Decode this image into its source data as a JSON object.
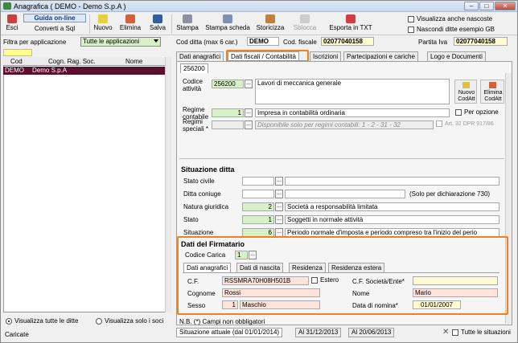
{
  "window": {
    "title": "Anagrafica ( DEMO - Demo S.p.A )",
    "min": "–",
    "max": "□",
    "close": "✕"
  },
  "toolbar": {
    "esci": "Esci",
    "guida": "Guida on-line",
    "converti": "Converti a Sql",
    "nuovo": "Nuovo",
    "elimina": "Elimina",
    "salva": "Salva",
    "stampa": "Stampa",
    "stampa_scheda": "Stampa scheda",
    "storicizza": "Storicizza",
    "sblocca": "Sblocca",
    "esporta": "Esporta in TXT",
    "opt1": "Visualizza anche nascoste",
    "opt2": "Nascondi ditte esempio GB"
  },
  "filter": {
    "label": "Filtra per applicazione",
    "value": "Tutte le applicazioni"
  },
  "list": {
    "headers": [
      "Cod",
      "Cogn. Rag. Soc.",
      "Nome"
    ],
    "rows": [
      {
        "cod": "DEMO",
        "name": "Demo S.p.A",
        "nome": ""
      }
    ]
  },
  "left_bottom": {
    "r1": "Visualizza tutte le ditte",
    "r2": "Visualizza solo i soci"
  },
  "status": "Caricate",
  "header": {
    "cod_label": "Cod ditta (max 6 car.)",
    "cod": "DEMO",
    "cf_label": "Cod. fiscale",
    "cf": "02077040158",
    "piva_label": "Partita Iva",
    "piva": "02077040158"
  },
  "tabs": [
    "Dati anagrafici",
    "Dati fiscali / Contabilità",
    "Iscrizioni",
    "Partecipazioni e cariche",
    "Logo e Documenti"
  ],
  "subtab": "256200",
  "fiscal": {
    "codice_label": "Codice attività",
    "codice": "256200",
    "codice_desc": "Lavori di meccanica generale",
    "nuovo": "Nuovo CodAtt",
    "elimina": "Elimina CodAtt",
    "regime_label": "Regime contabile",
    "regime": "1",
    "regime_desc": "Impresa  in contabilità ordinaria",
    "opzione": "Per opzione",
    "speciali_label": "Regimi speciali *",
    "speciali_desc": "Disponibile solo per regimi contabili: 1 - 2 - 31 - 32",
    "art": "Art. 32 DPR 917/86"
  },
  "situazione": {
    "title": "Situazione ditta",
    "stato_civile": "Stato civile",
    "coniuge": "Ditta coniuge",
    "coniuge_note": "(Solo per dichiarazione 730)",
    "natura_label": "Natura giuridica",
    "natura": "2",
    "natura_desc": "Società a responsabilità limitata",
    "stato_label": "Stato",
    "stato": "1",
    "stato_desc": "Soggetti in normale attività",
    "sit_label": "Situazione",
    "sit": "6",
    "sit_desc": "Periodo normale d'imposta e periodo compreso tra l'inizio del perio"
  },
  "firmatario": {
    "title": "Dati del Firmatario",
    "carica_label": "Codice Carica",
    "carica": "1",
    "tabs": [
      "Dati anagrafici",
      "Dati di nascita",
      "Residenza",
      "Residenza estera"
    ],
    "cf_label": "C.F.",
    "cf": "RSSMRA70H08H501B",
    "estero": "Estero",
    "cfsoc_label": "C.F. Società/Ente*",
    "cognome_label": "Cognome",
    "cognome": "Rossi",
    "nome_label": "Nome",
    "nome": "Mario",
    "sesso_label": "Sesso",
    "sesso": "1",
    "sesso_desc": "Maschio",
    "nomina_label": "Data di nomina*",
    "nomina": "01/01/2007"
  },
  "note": "N.B. (*) Campi non obbligatori",
  "bottom_tabs": [
    "Situazione attuale (dal 01/01/2014)",
    "Al 31/12/2013",
    "Al 20/06/2013"
  ],
  "tutte": "Tutte le situazioni"
}
